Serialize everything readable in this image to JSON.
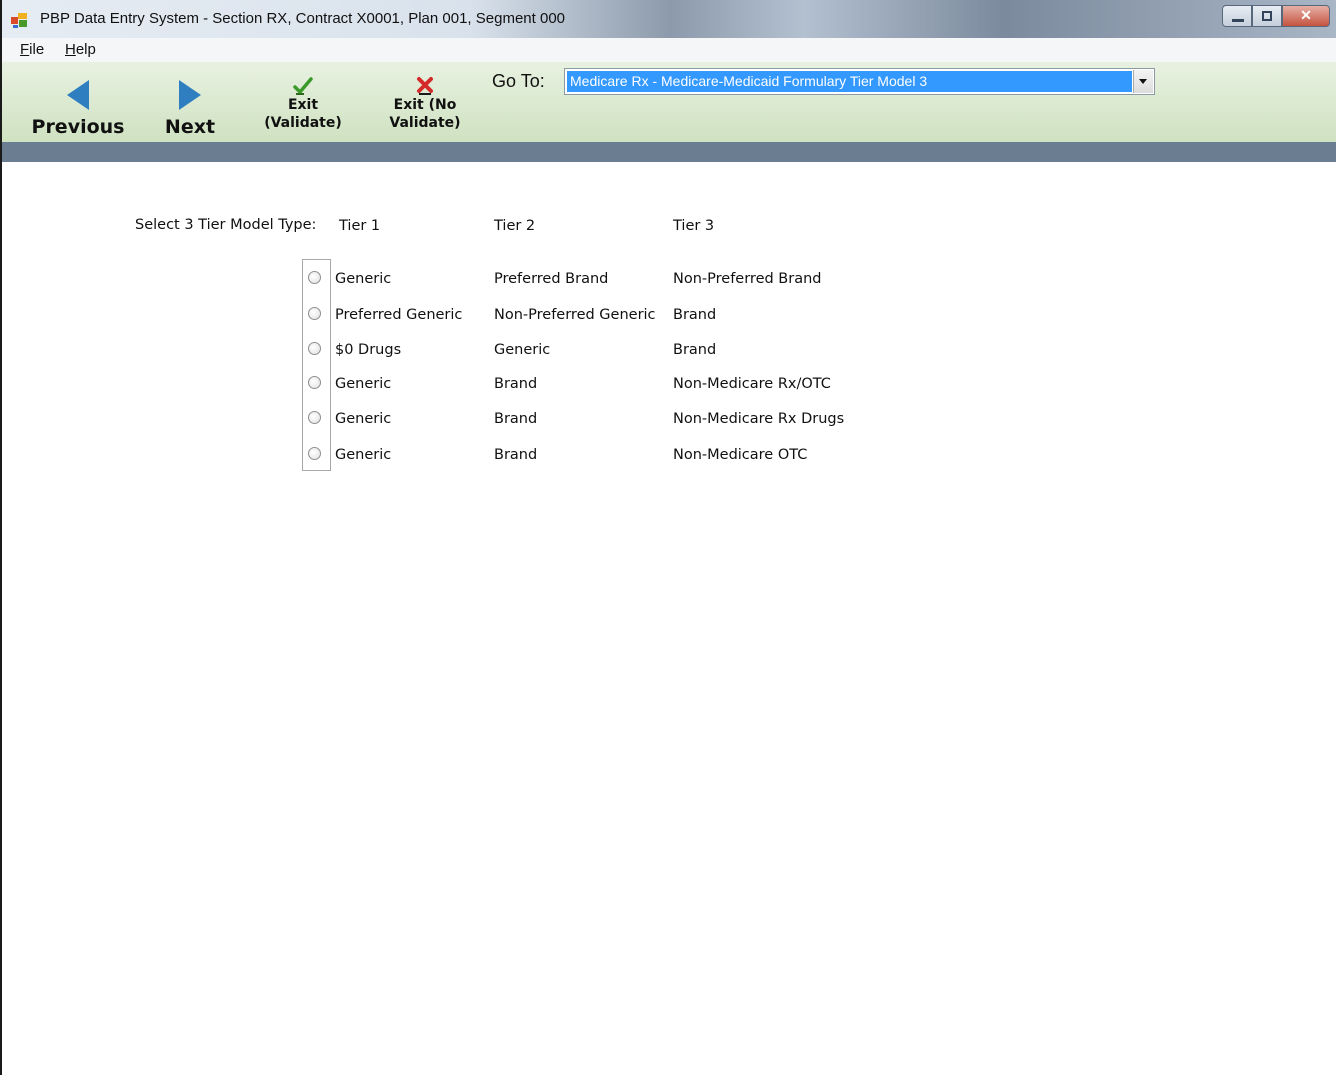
{
  "window": {
    "title": "PBP Data Entry System - Section RX, Contract X0001, Plan 001, Segment 000",
    "icon": "app-window-icon",
    "controls": {
      "close_glyph": "✕"
    }
  },
  "menu": {
    "file": {
      "accel": "F",
      "rest": "ile"
    },
    "help": {
      "accel": "H",
      "rest": "elp"
    }
  },
  "toolbar": {
    "previous_label": "Previous",
    "next_label": "Next",
    "exit_validate_line1": "Exit",
    "exit_validate_line2": "(Validate)",
    "exit_novalidate_line1": "Exit (No",
    "exit_novalidate_line2": "Validate)",
    "goto_label": "Go To:",
    "goto_selected": "Medicare Rx - Medicare-Medicaid Formulary Tier Model 3"
  },
  "form": {
    "prompt": "Select 3 Tier Model Type:",
    "headers": [
      "Tier 1",
      "Tier 2",
      "Tier 3"
    ],
    "options": [
      {
        "tier1": "Generic",
        "tier2": "Preferred Brand",
        "tier3": "Non-Preferred Brand"
      },
      {
        "tier1": "Preferred Generic",
        "tier2": "Non-Preferred Generic",
        "tier3": "Brand"
      },
      {
        "tier1": "$0 Drugs",
        "tier2": "Generic",
        "tier3": "Brand"
      },
      {
        "tier1": "Generic",
        "tier2": "Brand",
        "tier3": "Non-Medicare Rx/OTC"
      },
      {
        "tier1": "Generic",
        "tier2": "Brand",
        "tier3": "Non-Medicare Rx Drugs"
      },
      {
        "tier1": "Generic",
        "tier2": "Brand",
        "tier3": "Non-Medicare OTC"
      }
    ],
    "selected_index": null
  },
  "colors": {
    "toolbar_bg": "#d9e9cc",
    "band": "#6b7d91",
    "selection": "#3399ff",
    "arrow": "#2f7fc0"
  }
}
